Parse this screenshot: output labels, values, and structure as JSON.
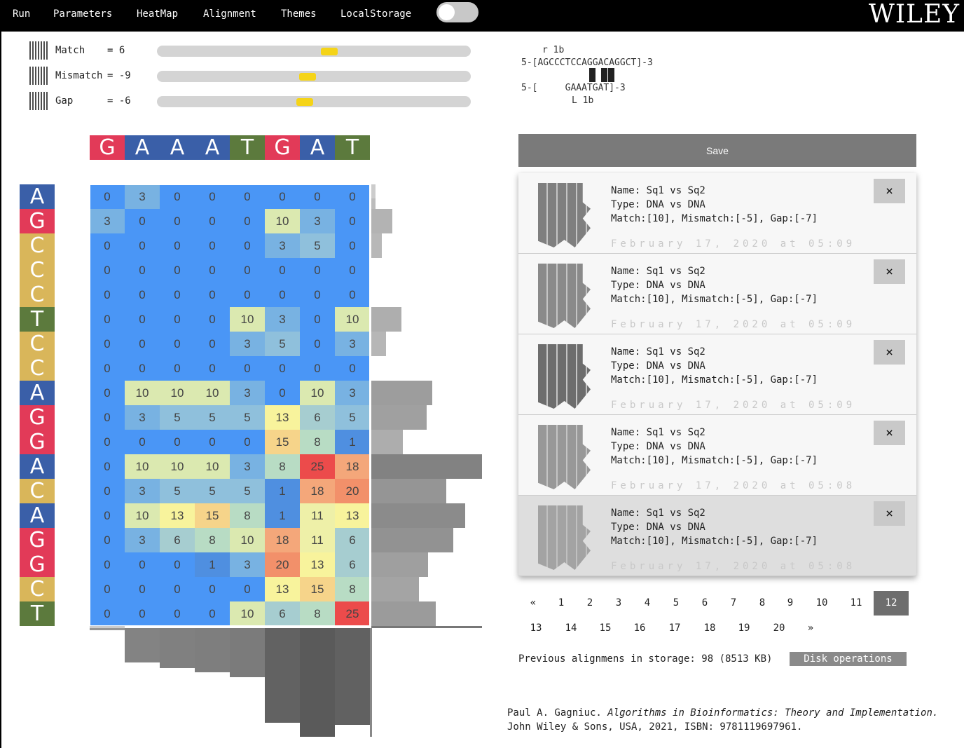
{
  "menu": [
    "Run",
    "Parameters",
    "HeatMap",
    "Alignment",
    "Themes",
    "LocalStorage"
  ],
  "brand": "WILEY",
  "params": [
    {
      "label": "Match",
      "value": "= 6",
      "level": 0.55
    },
    {
      "label": "Mismatch",
      "value": "= -9",
      "level": 0.48
    },
    {
      "label": "Gap",
      "value": "= -6",
      "level": 0.47
    }
  ],
  "colors": {
    "A": "#3a5fa8",
    "G": "#e23a58",
    "C": "#d9b65a",
    "T": "#5c7a3d"
  },
  "seq_top": [
    "G",
    "A",
    "A",
    "A",
    "T",
    "G",
    "A",
    "T"
  ],
  "seq_side": [
    "A",
    "G",
    "C",
    "C",
    "C",
    "T",
    "C",
    "C",
    "A",
    "G",
    "G",
    "A",
    "C",
    "A",
    "G",
    "G",
    "C",
    "T"
  ],
  "matrix": [
    [
      0,
      3,
      0,
      0,
      0,
      0,
      0,
      0
    ],
    [
      3,
      0,
      0,
      0,
      0,
      10,
      3,
      0
    ],
    [
      0,
      0,
      0,
      0,
      0,
      3,
      5,
      0
    ],
    [
      0,
      0,
      0,
      0,
      0,
      0,
      0,
      0
    ],
    [
      0,
      0,
      0,
      0,
      0,
      0,
      0,
      0
    ],
    [
      0,
      0,
      0,
      0,
      10,
      3,
      0,
      10
    ],
    [
      0,
      0,
      0,
      0,
      3,
      5,
      0,
      3
    ],
    [
      0,
      0,
      0,
      0,
      0,
      0,
      0,
      0
    ],
    [
      0,
      10,
      10,
      10,
      3,
      0,
      10,
      3
    ],
    [
      0,
      3,
      5,
      5,
      5,
      13,
      6,
      5
    ],
    [
      0,
      0,
      0,
      0,
      0,
      15,
      8,
      1
    ],
    [
      0,
      10,
      10,
      10,
      3,
      8,
      25,
      18
    ],
    [
      0,
      3,
      5,
      5,
      5,
      1,
      18,
      20
    ],
    [
      0,
      10,
      13,
      15,
      8,
      1,
      11,
      13
    ],
    [
      0,
      3,
      6,
      8,
      10,
      18,
      11,
      6
    ],
    [
      0,
      0,
      0,
      1,
      3,
      20,
      13,
      6
    ],
    [
      0,
      0,
      0,
      0,
      0,
      13,
      15,
      8
    ],
    [
      0,
      0,
      0,
      0,
      10,
      6,
      8,
      25
    ]
  ],
  "alignment": {
    "line1_marker": "r 1b",
    "line1": "5-[AGCCCTCCAGGACAGGCT]-3",
    "line2": "5-[     GAAATGAT]-3",
    "line2_marker": "L 1b"
  },
  "save_label": "Save",
  "entries": [
    {
      "name": "Name: Sq1 vs Sq2",
      "type": "Type: DNA vs DNA",
      "params": "Match:[10], Mismatch:[-5], Gap:[-7]",
      "date": "February 17, 2020 at 05:09"
    },
    {
      "name": "Name: Sq1 vs Sq2",
      "type": "Type: DNA vs DNA",
      "params": "Match:[10], Mismatch:[-5], Gap:[-7]",
      "date": "February 17, 2020 at 05:09"
    },
    {
      "name": "Name: Sq1 vs Sq2",
      "type": "Type: DNA vs DNA",
      "params": "Match:[10], Mismatch:[-5], Gap:[-7]",
      "date": "February 17, 2020 at 05:09"
    },
    {
      "name": "Name: Sq1 vs Sq2",
      "type": "Type: DNA vs DNA",
      "params": "Match:[10], Mismatch:[-5], Gap:[-7]",
      "date": "February 17, 2020 at 05:08"
    },
    {
      "name": "Name: Sq1 vs Sq2",
      "type": "Type: DNA vs DNA",
      "params": "Match:[10], Mismatch:[-5], Gap:[-7]",
      "date": "February 17, 2020 at 05:08"
    }
  ],
  "close_symbol": "×",
  "pagination": {
    "row1": [
      "«",
      "1",
      "2",
      "3",
      "4",
      "5",
      "6",
      "7",
      "8",
      "9",
      "10",
      "11",
      "12"
    ],
    "row2": [
      "13",
      "14",
      "15",
      "16",
      "17",
      "18",
      "19",
      "20",
      "»"
    ],
    "active": "12"
  },
  "storage_text": "Previous alignmens in storage: 98 (8513 KB)",
  "disk_label": "Disk operations",
  "reference": {
    "author": "Paul A. Gagniuc. ",
    "title": "Algorithms in Bioinformatics: Theory and Implementation.",
    "line2": "John Wiley & Sons, USA, 2021, ISBN: 9781119697961."
  }
}
